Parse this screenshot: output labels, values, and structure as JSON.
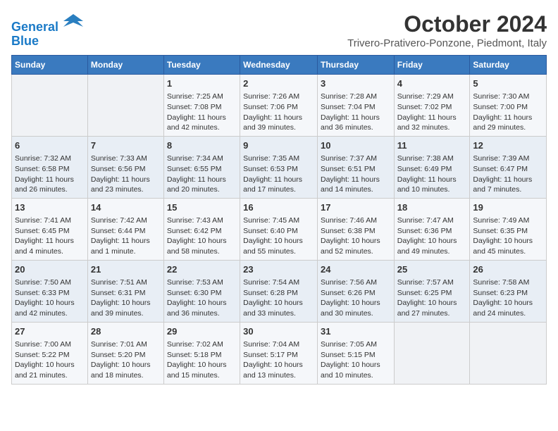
{
  "logo": {
    "line1": "General",
    "line2": "Blue"
  },
  "title": "October 2024",
  "subtitle": "Trivero-Prativero-Ponzone, Piedmont, Italy",
  "days_of_week": [
    "Sunday",
    "Monday",
    "Tuesday",
    "Wednesday",
    "Thursday",
    "Friday",
    "Saturday"
  ],
  "weeks": [
    [
      {
        "day": "",
        "info": ""
      },
      {
        "day": "",
        "info": ""
      },
      {
        "day": "1",
        "info": "Sunrise: 7:25 AM\nSunset: 7:08 PM\nDaylight: 11 hours and 42 minutes."
      },
      {
        "day": "2",
        "info": "Sunrise: 7:26 AM\nSunset: 7:06 PM\nDaylight: 11 hours and 39 minutes."
      },
      {
        "day": "3",
        "info": "Sunrise: 7:28 AM\nSunset: 7:04 PM\nDaylight: 11 hours and 36 minutes."
      },
      {
        "day": "4",
        "info": "Sunrise: 7:29 AM\nSunset: 7:02 PM\nDaylight: 11 hours and 32 minutes."
      },
      {
        "day": "5",
        "info": "Sunrise: 7:30 AM\nSunset: 7:00 PM\nDaylight: 11 hours and 29 minutes."
      }
    ],
    [
      {
        "day": "6",
        "info": "Sunrise: 7:32 AM\nSunset: 6:58 PM\nDaylight: 11 hours and 26 minutes."
      },
      {
        "day": "7",
        "info": "Sunrise: 7:33 AM\nSunset: 6:56 PM\nDaylight: 11 hours and 23 minutes."
      },
      {
        "day": "8",
        "info": "Sunrise: 7:34 AM\nSunset: 6:55 PM\nDaylight: 11 hours and 20 minutes."
      },
      {
        "day": "9",
        "info": "Sunrise: 7:35 AM\nSunset: 6:53 PM\nDaylight: 11 hours and 17 minutes."
      },
      {
        "day": "10",
        "info": "Sunrise: 7:37 AM\nSunset: 6:51 PM\nDaylight: 11 hours and 14 minutes."
      },
      {
        "day": "11",
        "info": "Sunrise: 7:38 AM\nSunset: 6:49 PM\nDaylight: 11 hours and 10 minutes."
      },
      {
        "day": "12",
        "info": "Sunrise: 7:39 AM\nSunset: 6:47 PM\nDaylight: 11 hours and 7 minutes."
      }
    ],
    [
      {
        "day": "13",
        "info": "Sunrise: 7:41 AM\nSunset: 6:45 PM\nDaylight: 11 hours and 4 minutes."
      },
      {
        "day": "14",
        "info": "Sunrise: 7:42 AM\nSunset: 6:44 PM\nDaylight: 11 hours and 1 minute."
      },
      {
        "day": "15",
        "info": "Sunrise: 7:43 AM\nSunset: 6:42 PM\nDaylight: 10 hours and 58 minutes."
      },
      {
        "day": "16",
        "info": "Sunrise: 7:45 AM\nSunset: 6:40 PM\nDaylight: 10 hours and 55 minutes."
      },
      {
        "day": "17",
        "info": "Sunrise: 7:46 AM\nSunset: 6:38 PM\nDaylight: 10 hours and 52 minutes."
      },
      {
        "day": "18",
        "info": "Sunrise: 7:47 AM\nSunset: 6:36 PM\nDaylight: 10 hours and 49 minutes."
      },
      {
        "day": "19",
        "info": "Sunrise: 7:49 AM\nSunset: 6:35 PM\nDaylight: 10 hours and 45 minutes."
      }
    ],
    [
      {
        "day": "20",
        "info": "Sunrise: 7:50 AM\nSunset: 6:33 PM\nDaylight: 10 hours and 42 minutes."
      },
      {
        "day": "21",
        "info": "Sunrise: 7:51 AM\nSunset: 6:31 PM\nDaylight: 10 hours and 39 minutes."
      },
      {
        "day": "22",
        "info": "Sunrise: 7:53 AM\nSunset: 6:30 PM\nDaylight: 10 hours and 36 minutes."
      },
      {
        "day": "23",
        "info": "Sunrise: 7:54 AM\nSunset: 6:28 PM\nDaylight: 10 hours and 33 minutes."
      },
      {
        "day": "24",
        "info": "Sunrise: 7:56 AM\nSunset: 6:26 PM\nDaylight: 10 hours and 30 minutes."
      },
      {
        "day": "25",
        "info": "Sunrise: 7:57 AM\nSunset: 6:25 PM\nDaylight: 10 hours and 27 minutes."
      },
      {
        "day": "26",
        "info": "Sunrise: 7:58 AM\nSunset: 6:23 PM\nDaylight: 10 hours and 24 minutes."
      }
    ],
    [
      {
        "day": "27",
        "info": "Sunrise: 7:00 AM\nSunset: 5:22 PM\nDaylight: 10 hours and 21 minutes."
      },
      {
        "day": "28",
        "info": "Sunrise: 7:01 AM\nSunset: 5:20 PM\nDaylight: 10 hours and 18 minutes."
      },
      {
        "day": "29",
        "info": "Sunrise: 7:02 AM\nSunset: 5:18 PM\nDaylight: 10 hours and 15 minutes."
      },
      {
        "day": "30",
        "info": "Sunrise: 7:04 AM\nSunset: 5:17 PM\nDaylight: 10 hours and 13 minutes."
      },
      {
        "day": "31",
        "info": "Sunrise: 7:05 AM\nSunset: 5:15 PM\nDaylight: 10 hours and 10 minutes."
      },
      {
        "day": "",
        "info": ""
      },
      {
        "day": "",
        "info": ""
      }
    ]
  ]
}
